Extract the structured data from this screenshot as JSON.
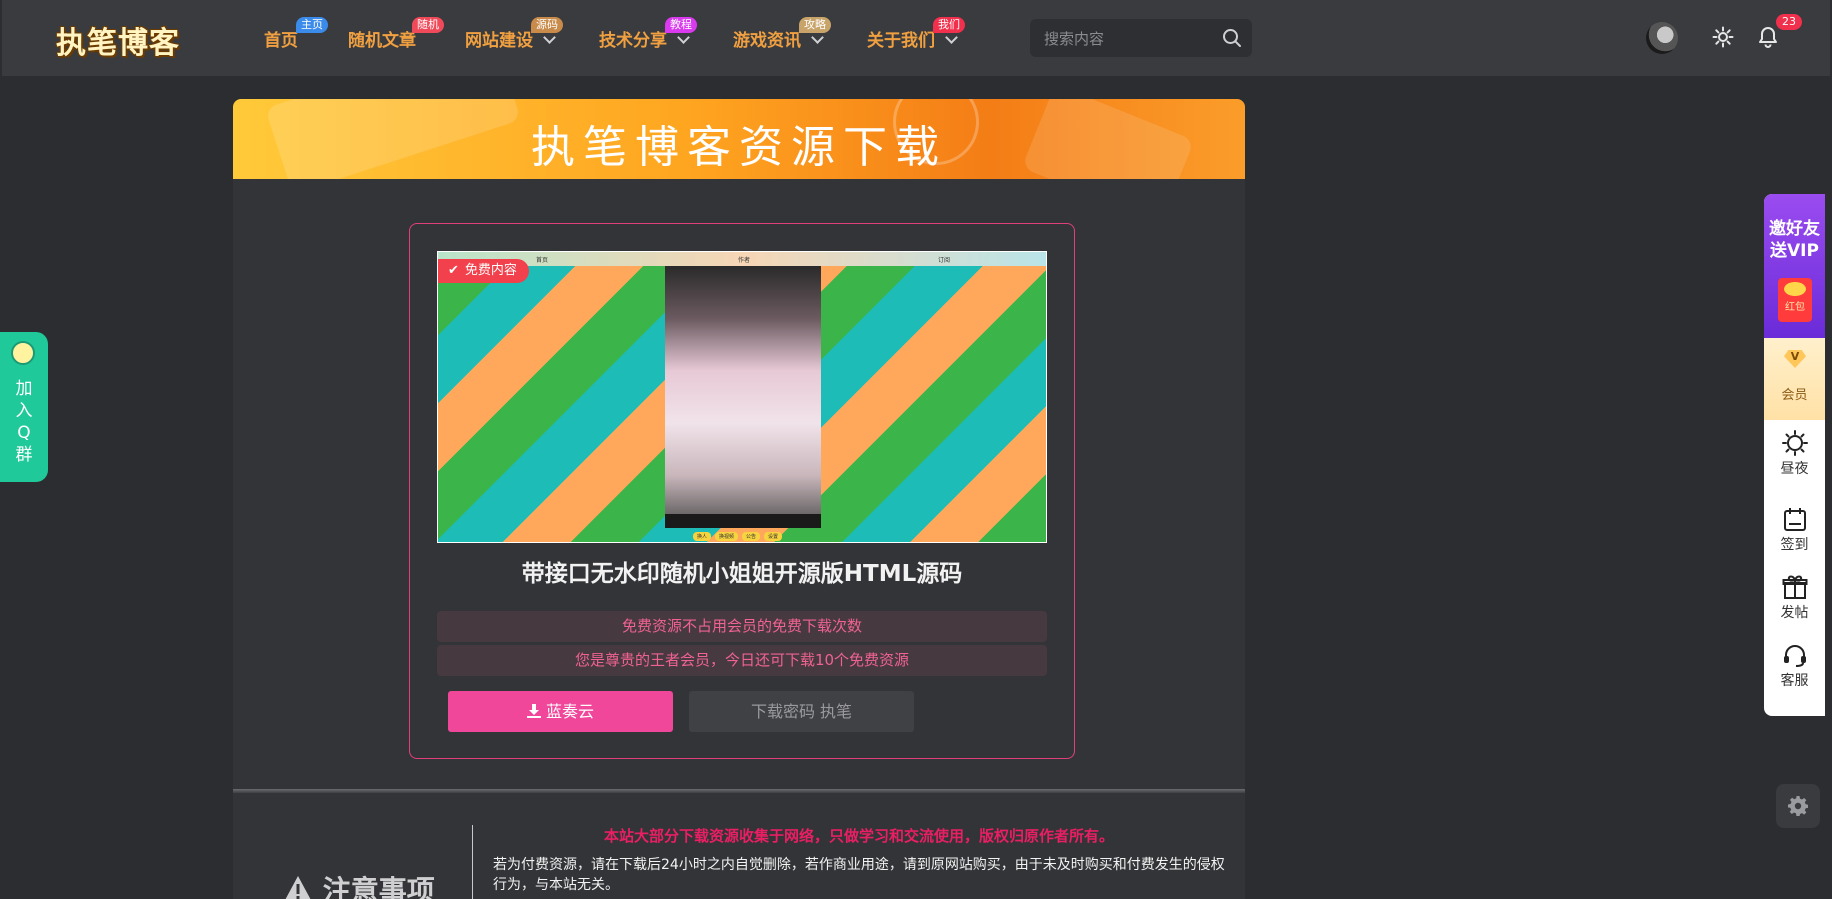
{
  "header": {
    "logo": "执笔博客",
    "nav": [
      {
        "label": "首页",
        "badge": "主页",
        "badge_color": "#3b8bea",
        "dropdown": false
      },
      {
        "label": "随机文章",
        "badge": "随机",
        "badge_color": "#f04a5a",
        "dropdown": false
      },
      {
        "label": "网站建设",
        "badge": "源码",
        "badge_color": "#c98b4a",
        "dropdown": true
      },
      {
        "label": "技术分享",
        "badge": "教程",
        "badge_color": "#d93aef",
        "dropdown": true
      },
      {
        "label": "游戏资讯",
        "badge": "攻略",
        "badge_color": "#c9a46a",
        "dropdown": true
      },
      {
        "label": "关于我们",
        "badge": "我们",
        "badge_color": "#f0304c",
        "dropdown": true
      }
    ],
    "search_placeholder": "搜索内容",
    "notification_count": "23"
  },
  "banner": {
    "title": "执笔博客资源下载"
  },
  "resource": {
    "free_tag": "免费内容",
    "title": "带接口无水印随机小姐姐开源版HTML源码",
    "notice_1": "免费资源不占用会员的免费下载次数",
    "notice_2": "您是尊贵的王者会员，今日还可下载10个免费资源",
    "download_button": "蓝奏云",
    "password_text": "下载密码 执笔",
    "preview": {
      "topbar": [
        "首页",
        "作者",
        "订阅"
      ],
      "buttons": [
        "换人",
        "换视频",
        "公告",
        "设置"
      ]
    }
  },
  "notes": {
    "heading": "注意事项",
    "highlight": "本站大部分下载资源收集于网络，只做学习和交流使用，版权归原作者所有。",
    "text": "若为付费资源，请在下载后24小时之内自觉删除，若作商业用途，请到原网站购买，由于未及时购买和付费发生的侵权行为，与本站无关。"
  },
  "left_tab": {
    "label": "加入Q群"
  },
  "right_bar": {
    "invite": "邀好友送VIP",
    "red_packet": "红包",
    "vip_mark": "V",
    "vip": "会员",
    "items": [
      {
        "label": "昼夜",
        "icon": "sun-icon"
      },
      {
        "label": "签到",
        "icon": "calendar-icon"
      },
      {
        "label": "发帖",
        "icon": "gift-icon"
      },
      {
        "label": "客服",
        "icon": "headset-icon"
      }
    ]
  }
}
